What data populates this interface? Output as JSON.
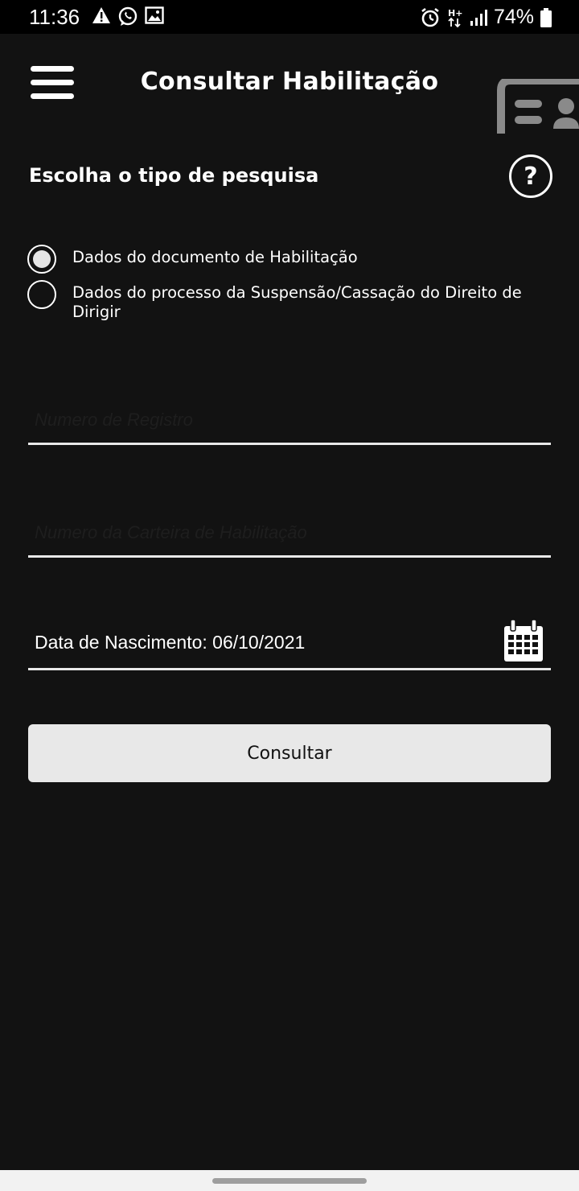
{
  "status_bar": {
    "time": "11:36",
    "battery": "74%",
    "left_icons": [
      "warning-icon",
      "whatsapp-icon",
      "image-icon"
    ],
    "right_icons": [
      "alarm-icon",
      "network-hplus-icon",
      "signal-icon",
      "battery-icon"
    ]
  },
  "app_bar": {
    "title": "Consultar Habilitação",
    "menu_icon": "hamburger-menu-icon",
    "card_icon": "license-card-icon"
  },
  "search_type": {
    "title": "Escolha o tipo de pesquisa",
    "help_glyph": "?",
    "options": [
      {
        "label": "Dados do documento de Habilitação",
        "selected": true
      },
      {
        "label": "Dados do processo da Suspensão/Cassação do Direito de Dirigir",
        "selected": false
      }
    ]
  },
  "form": {
    "registro_placeholder": "Numero de Registro",
    "registro_value": "",
    "carteira_placeholder": "Numero da Carteira de Habilitação",
    "carteira_value": "",
    "birth_date_text": "Data de Nascimento: 06/10/2021"
  },
  "actions": {
    "consult_label": "Consultar"
  },
  "colors": {
    "background": "#121212",
    "status_bar": "#000000",
    "button_bg": "#e8e8e8",
    "underline": "#e8e8e8",
    "card_icon": "#8a8a8a"
  }
}
